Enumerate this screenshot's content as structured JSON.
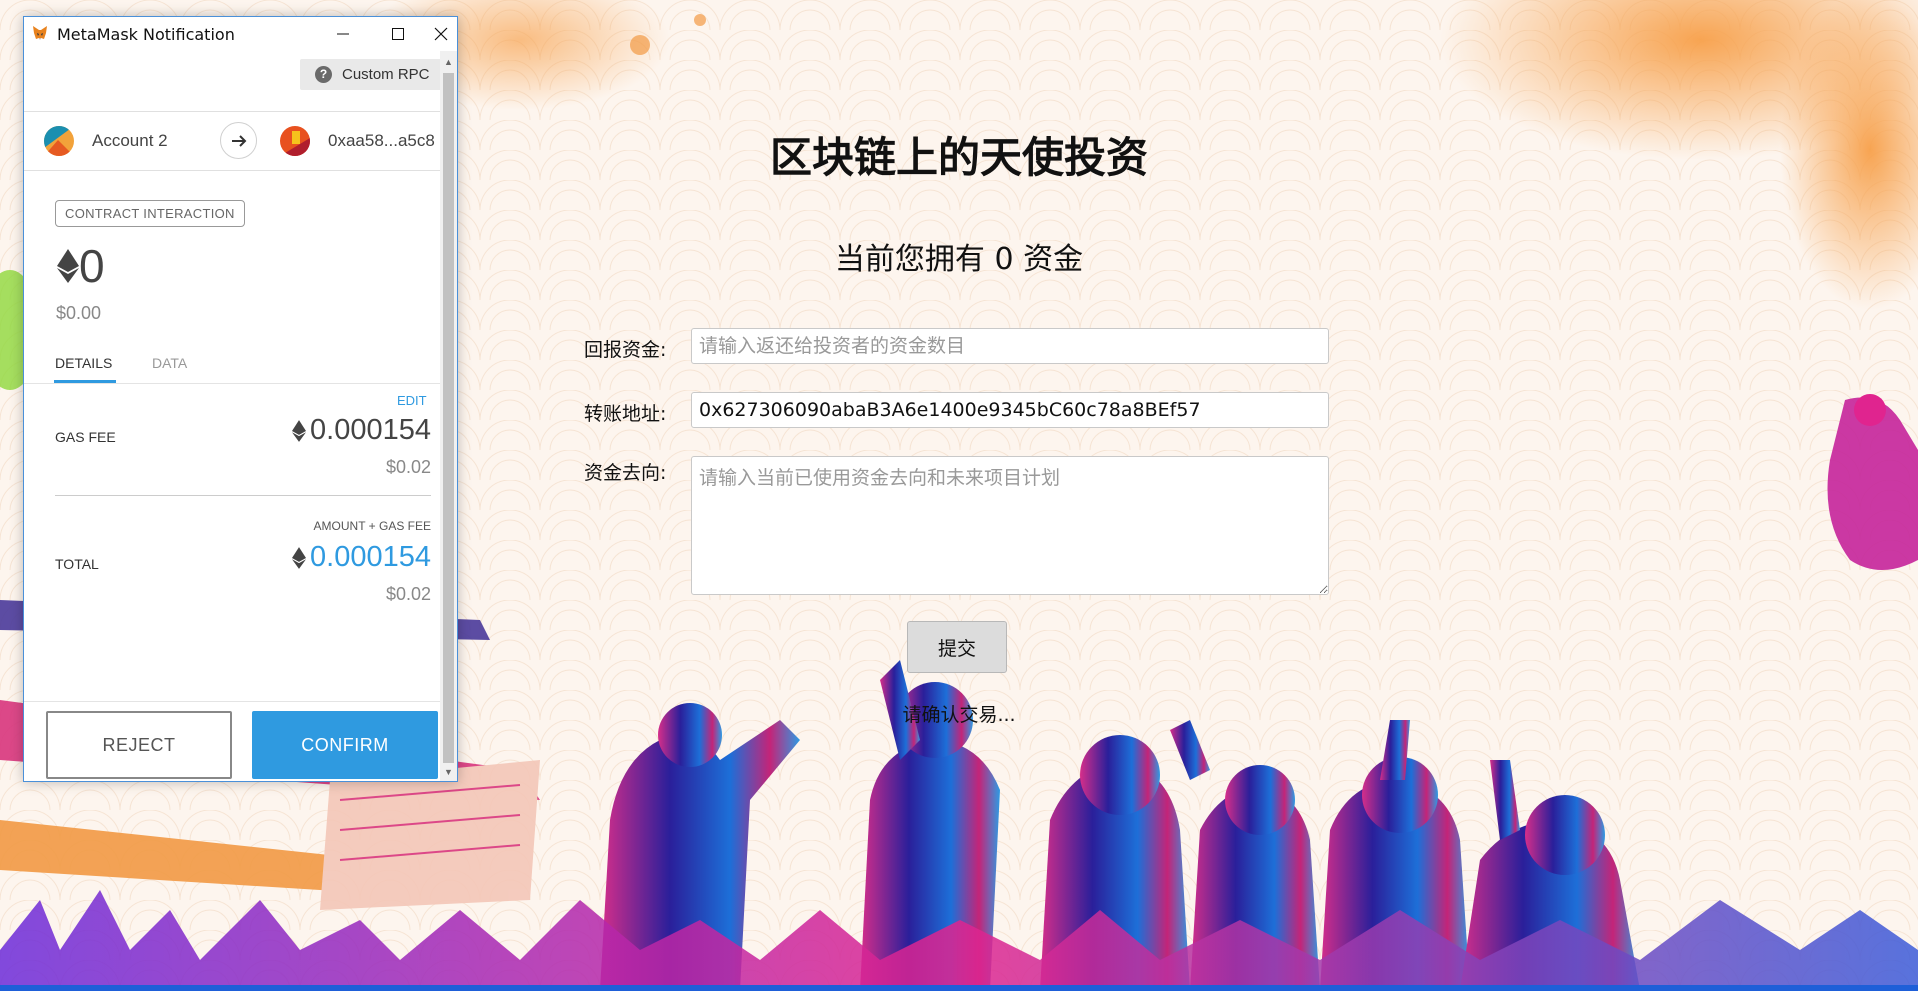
{
  "colors": {
    "accent": "#2f9ae0",
    "window_border": "#4a90d9"
  },
  "dapp": {
    "title": "区块链上的天使投资",
    "funds_line": "当前您拥有 0 资金",
    "fields": {
      "return_label": "回报资金:",
      "return_placeholder": "请输入返还给投资者的资金数目",
      "address_label": "转账地址:",
      "address_value": "0x627306090abaB3A6e1400e9345bC60c78a8BEf57",
      "purpose_label": "资金去向:",
      "purpose_placeholder": "请输入当前已使用资金去向和未来项目计划"
    },
    "submit_label": "提交",
    "status": "请确认交易..."
  },
  "metamask": {
    "window_title": "MetaMask Notification",
    "network": "Custom RPC",
    "from_account": "Account 2",
    "to_address": "0xaa58...a5c8",
    "badge": "CONTRACT INTERACTION",
    "amount": "0",
    "amount_fiat": "$0.00",
    "tabs": [
      "DETAILS",
      "DATA"
    ],
    "active_tab": "DETAILS",
    "edit_label": "EDIT",
    "gas_fee": {
      "label": "GAS FEE",
      "value": "0.000154",
      "fiat": "$0.02"
    },
    "total": {
      "caption": "AMOUNT + GAS FEE",
      "label": "TOTAL",
      "value": "0.000154",
      "fiat": "$0.02"
    },
    "reject_label": "REJECT",
    "confirm_label": "CONFIRM",
    "icons": [
      "metamask-fox-icon",
      "minimize-icon",
      "maximize-icon",
      "close-icon",
      "help-icon",
      "arrow-right-icon",
      "eth-icon"
    ]
  }
}
